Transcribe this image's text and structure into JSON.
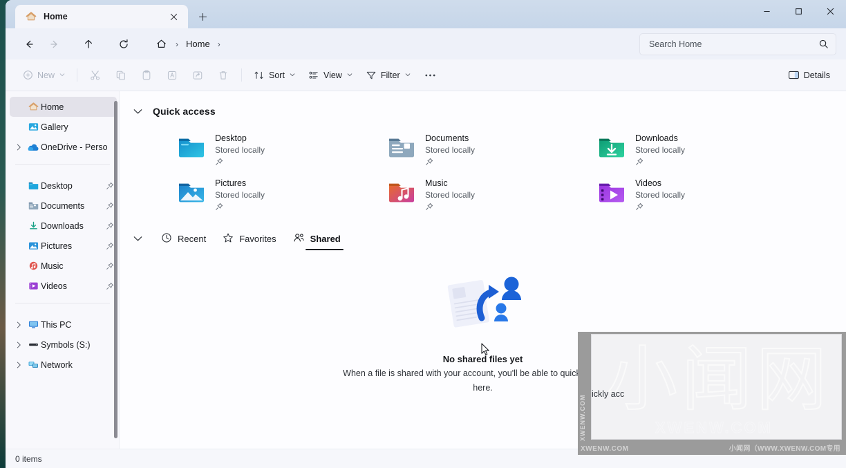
{
  "window": {
    "tab": {
      "title": "Home",
      "icon": "home-icon",
      "close_label": "×"
    },
    "new_tab_label": "+",
    "controls": {
      "minimize": "–",
      "maximize": "□",
      "close": "✕"
    }
  },
  "nav": {
    "back_label": "←",
    "forward_label": "→",
    "up_label": "↑",
    "refresh_label": "↻",
    "breadcrumb": {
      "home_icon": "home-icon",
      "sep1": "›",
      "text": "Home",
      "sep2": "›"
    },
    "search": {
      "placeholder": "Search Home",
      "value": "",
      "icon": "search-icon"
    }
  },
  "toolbar": {
    "new_label": "New",
    "cut_label": "Cut",
    "copy_label": "Copy",
    "paste_label": "Paste",
    "rename_label": "Rename",
    "share_label": "Share",
    "delete_label": "Delete",
    "sort_label": "Sort",
    "view_label": "View",
    "filter_label": "Filter",
    "more_label": "•••",
    "details_label": "Details",
    "chevron": "⌄"
  },
  "sidebar": {
    "items": [
      {
        "label": "Home",
        "icon": "home-icon",
        "selected": true,
        "expandable": false,
        "pinned": false
      },
      {
        "label": "Gallery",
        "icon": "gallery-icon",
        "selected": false,
        "expandable": false,
        "pinned": false
      },
      {
        "label": "OneDrive - Perso",
        "icon": "onedrive-icon",
        "selected": false,
        "expandable": true,
        "pinned": false
      },
      {
        "label": "Desktop",
        "icon": "desktop-folder-icon",
        "selected": false,
        "expandable": false,
        "pinned": true
      },
      {
        "label": "Documents",
        "icon": "documents-folder-icon",
        "selected": false,
        "expandable": false,
        "pinned": true
      },
      {
        "label": "Downloads",
        "icon": "downloads-folder-icon",
        "selected": false,
        "expandable": false,
        "pinned": true
      },
      {
        "label": "Pictures",
        "icon": "pictures-folder-icon",
        "selected": false,
        "expandable": false,
        "pinned": true
      },
      {
        "label": "Music",
        "icon": "music-folder-icon",
        "selected": false,
        "expandable": false,
        "pinned": true
      },
      {
        "label": "Videos",
        "icon": "videos-folder-icon",
        "selected": false,
        "expandable": false,
        "pinned": true
      },
      {
        "label": "This PC",
        "icon": "this-pc-icon",
        "selected": false,
        "expandable": true,
        "pinned": false
      },
      {
        "label": "Symbols (S:)",
        "icon": "drive-icon",
        "selected": false,
        "expandable": true,
        "pinned": false
      },
      {
        "label": "Network",
        "icon": "network-icon",
        "selected": false,
        "expandable": true,
        "pinned": false
      }
    ],
    "expander_glyph": "›"
  },
  "main": {
    "quick_access": {
      "title": "Quick access",
      "chevron": "⌄",
      "items": [
        {
          "name": "Desktop",
          "status": "Stored locally",
          "icon": "desktop-folder-icon",
          "pinned": true
        },
        {
          "name": "Documents",
          "status": "Stored locally",
          "icon": "documents-folder-icon",
          "pinned": true
        },
        {
          "name": "Downloads",
          "status": "Stored locally",
          "icon": "downloads-folder-icon",
          "pinned": true
        },
        {
          "name": "Pictures",
          "status": "Stored locally",
          "icon": "pictures-folder-icon",
          "pinned": true
        },
        {
          "name": "Music",
          "status": "Stored locally",
          "icon": "music-folder-icon",
          "pinned": true
        },
        {
          "name": "Videos",
          "status": "Stored locally",
          "icon": "videos-folder-icon",
          "pinned": true
        }
      ]
    },
    "file_tabs": {
      "chevron": "⌄",
      "tabs": [
        {
          "label": "Recent",
          "icon": "clock-icon",
          "active": false
        },
        {
          "label": "Favorites",
          "icon": "star-icon",
          "active": false
        },
        {
          "label": "Shared",
          "icon": "people-icon",
          "active": true
        }
      ]
    },
    "empty_state": {
      "title": "No shared files yet",
      "description": "When a file is shared with your account, you'll be able to quickly access it here.",
      "art": "shared-files-illustration"
    }
  },
  "statusbar": {
    "items_text": "0 items"
  },
  "watermark": {
    "big_text": "小闻网",
    "sub_text": "XWENW.COM",
    "side_text": "XWENW.COM",
    "footer_left": "XWENW.COM",
    "footer_right": "小闻网（WWW.XWENW.COM专用",
    "occluded_text": "ickly acc"
  },
  "colors": {
    "titlebar": "#c6d6e9",
    "accent_blue": "#1f5fd0",
    "selected_nav": "#e3e2ea",
    "folder_desktop": "#14a4d8",
    "folder_documents": "#7e98ad",
    "folder_downloads": "#13a37f",
    "folder_pictures": "#2a8fd4",
    "folder_music": "#d9554f",
    "folder_videos": "#9b3fd4"
  }
}
